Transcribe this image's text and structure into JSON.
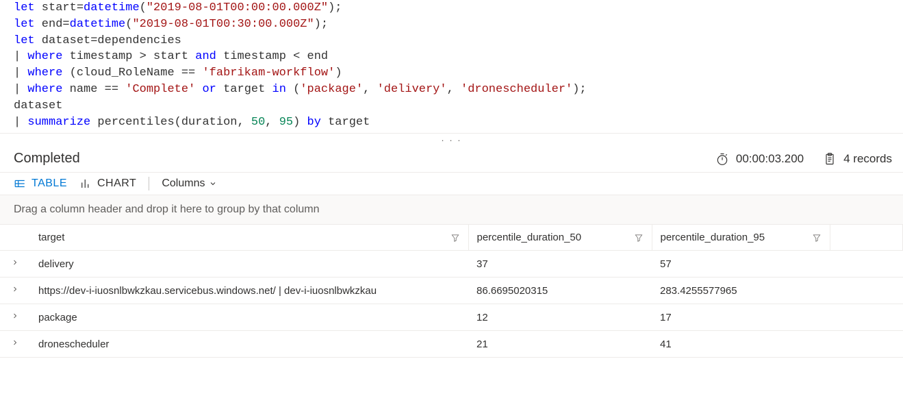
{
  "code": {
    "lines": [
      [
        {
          "cls": "tok-kw",
          "t": "let"
        },
        {
          "cls": "tok-ident",
          "t": " start="
        },
        {
          "cls": "tok-fn",
          "t": "datetime"
        },
        {
          "cls": "tok-punct",
          "t": "("
        },
        {
          "cls": "tok-str",
          "t": "\"2019-08-01T00:00:00.000Z\""
        },
        {
          "cls": "tok-punct",
          "t": ");"
        }
      ],
      [
        {
          "cls": "tok-kw",
          "t": "let"
        },
        {
          "cls": "tok-ident",
          "t": " end="
        },
        {
          "cls": "tok-fn",
          "t": "datetime"
        },
        {
          "cls": "tok-punct",
          "t": "("
        },
        {
          "cls": "tok-str",
          "t": "\"2019-08-01T00:30:00.000Z\""
        },
        {
          "cls": "tok-punct",
          "t": ");"
        }
      ],
      [
        {
          "cls": "tok-kw",
          "t": "let"
        },
        {
          "cls": "tok-ident",
          "t": " dataset=dependencies"
        }
      ],
      [
        {
          "cls": "tok-punct",
          "t": "| "
        },
        {
          "cls": "tok-kw",
          "t": "where"
        },
        {
          "cls": "tok-ident",
          "t": " timestamp > start "
        },
        {
          "cls": "tok-kw",
          "t": "and"
        },
        {
          "cls": "tok-ident",
          "t": " timestamp < end"
        }
      ],
      [
        {
          "cls": "tok-punct",
          "t": "| "
        },
        {
          "cls": "tok-kw",
          "t": "where"
        },
        {
          "cls": "tok-ident",
          "t": " (cloud_RoleName == "
        },
        {
          "cls": "tok-str",
          "t": "'fabrikam-workflow'"
        },
        {
          "cls": "tok-punct",
          "t": ")"
        }
      ],
      [
        {
          "cls": "tok-punct",
          "t": "| "
        },
        {
          "cls": "tok-kw",
          "t": "where"
        },
        {
          "cls": "tok-ident",
          "t": " name == "
        },
        {
          "cls": "tok-str",
          "t": "'Complete'"
        },
        {
          "cls": "tok-ident",
          "t": " "
        },
        {
          "cls": "tok-kw",
          "t": "or"
        },
        {
          "cls": "tok-ident",
          "t": " target "
        },
        {
          "cls": "tok-kw",
          "t": "in"
        },
        {
          "cls": "tok-ident",
          "t": " ("
        },
        {
          "cls": "tok-str",
          "t": "'package'"
        },
        {
          "cls": "tok-punct",
          "t": ", "
        },
        {
          "cls": "tok-str",
          "t": "'delivery'"
        },
        {
          "cls": "tok-punct",
          "t": ", "
        },
        {
          "cls": "tok-str",
          "t": "'dronescheduler'"
        },
        {
          "cls": "tok-punct",
          "t": ");"
        }
      ],
      [
        {
          "cls": "tok-ident",
          "t": "dataset"
        }
      ],
      [
        {
          "cls": "tok-punct",
          "t": "| "
        },
        {
          "cls": "tok-kw",
          "t": "summarize"
        },
        {
          "cls": "tok-ident",
          "t": " percentiles(duration, "
        },
        {
          "cls": "tok-num",
          "t": "50"
        },
        {
          "cls": "tok-punct",
          "t": ", "
        },
        {
          "cls": "tok-num",
          "t": "95"
        },
        {
          "cls": "tok-punct",
          "t": ") "
        },
        {
          "cls": "tok-kw",
          "t": "by"
        },
        {
          "cls": "tok-ident",
          "t": " target"
        }
      ]
    ]
  },
  "status": {
    "label": "Completed",
    "duration": "00:00:03.200",
    "record_count": "4 records"
  },
  "toolbar": {
    "table_label": "TABLE",
    "chart_label": "CHART",
    "columns_label": "Columns"
  },
  "group_hint": "Drag a column header and drop it here to group by that column",
  "columns": {
    "0": "target",
    "1": "percentile_duration_50",
    "2": "percentile_duration_95"
  },
  "rows": [
    {
      "target": "delivery",
      "p50": "37",
      "p95": "57"
    },
    {
      "target": "https://dev-i-iuosnlbwkzkau.servicebus.windows.net/ | dev-i-iuosnlbwkzkau",
      "p50": "86.6695020315",
      "p95": "283.4255577965"
    },
    {
      "target": "package",
      "p50": "12",
      "p95": "17"
    },
    {
      "target": "dronescheduler",
      "p50": "21",
      "p95": "41"
    }
  ]
}
